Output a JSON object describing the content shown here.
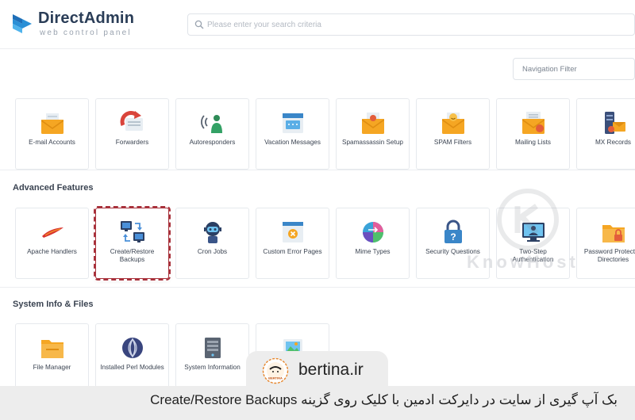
{
  "header": {
    "brand_name": "DirectAdmin",
    "brand_tagline": "web control panel",
    "search_placeholder": "Please enter your search criteria",
    "nav_filter_placeholder": "Navigation Filter"
  },
  "email_section": {
    "tiles": [
      {
        "label": "E-mail Accounts",
        "icon": "envelope-icon"
      },
      {
        "label": "Forwarders",
        "icon": "forward-icon"
      },
      {
        "label": "Autoresponders",
        "icon": "autoresponder-icon"
      },
      {
        "label": "Vacation Messages",
        "icon": "vacation-calendar-icon"
      },
      {
        "label": "Spamassassin Setup",
        "icon": "spam-envelope-icon"
      },
      {
        "label": "SPAM Filters",
        "icon": "spam-filter-icon"
      },
      {
        "label": "Mailing Lists",
        "icon": "mailing-list-icon"
      },
      {
        "label": "MX Records",
        "icon": "mx-server-icon"
      }
    ]
  },
  "advanced_section": {
    "title": "Advanced Features",
    "tiles": [
      {
        "label": "Apache Handlers",
        "icon": "apache-feather-icon"
      },
      {
        "label": "Create/Restore Backups",
        "icon": "backup-computers-icon"
      },
      {
        "label": "Cron Jobs",
        "icon": "robot-icon"
      },
      {
        "label": "Custom Error Pages",
        "icon": "error-page-icon"
      },
      {
        "label": "Mime Types",
        "icon": "mime-types-icon"
      },
      {
        "label": "Security Questions",
        "icon": "padlock-question-icon"
      },
      {
        "label": "Two-Step Authentication",
        "icon": "two-step-monitor-icon"
      },
      {
        "label": "Password Protected Directories",
        "icon": "locked-folder-icon"
      }
    ]
  },
  "system_section": {
    "title": "System Info & Files",
    "tiles": [
      {
        "label": "File Manager",
        "icon": "folder-icon"
      },
      {
        "label": "Installed Perl Modules",
        "icon": "perl-onion-icon"
      },
      {
        "label": "System Information",
        "icon": "system-info-icon"
      },
      {
        "label": "",
        "icon": "image-icon"
      }
    ]
  },
  "watermark": "KnowHost",
  "banner": {
    "site": "bertina.ir",
    "logo_text": "BERTINA",
    "caption": "بک آپ گیری از سایت در دایرکت ادمین با کلیک روی گزینه Create/Restore Backups"
  },
  "colors": {
    "highlight_border": "#a8313b",
    "brand_blue": "#2a8fd6",
    "banner_bg": "#ededed"
  }
}
